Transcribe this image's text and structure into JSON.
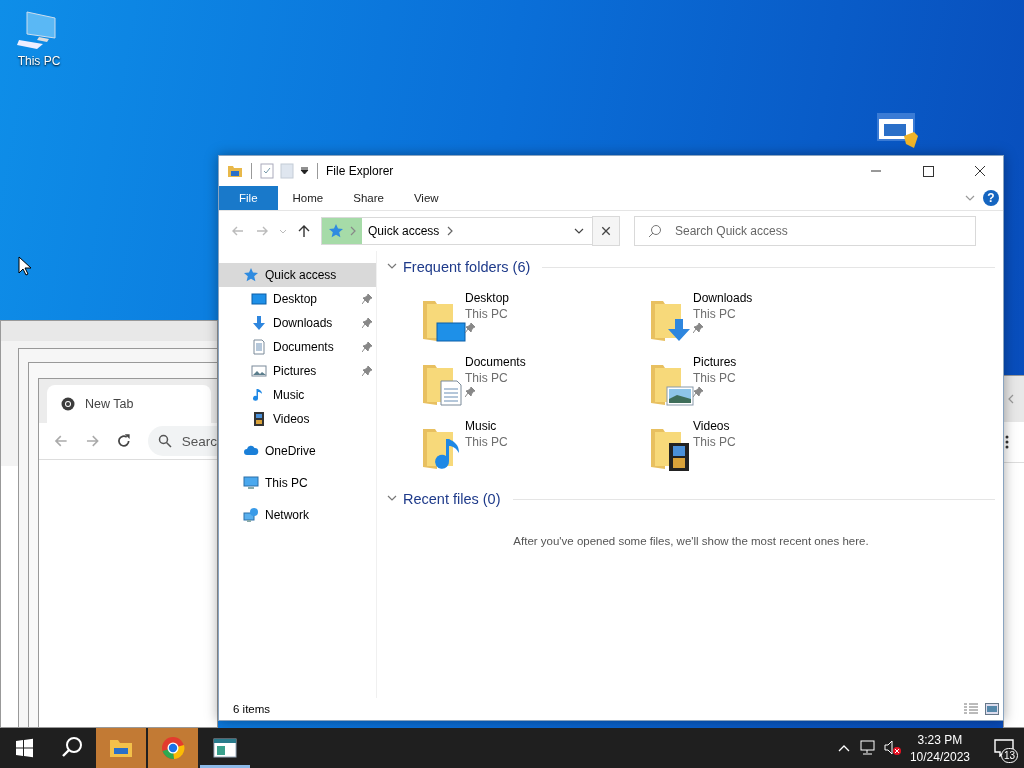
{
  "desktop_icons": [
    {
      "label": "This PC"
    }
  ],
  "browser_window": {
    "tab": "New Tab",
    "search_placeholder": "Searc"
  },
  "explorer": {
    "title": "File Explorer",
    "ribbon_tabs": [
      {
        "label": "File",
        "selected": true
      },
      {
        "label": "Home",
        "selected": false
      },
      {
        "label": "Share",
        "selected": false
      },
      {
        "label": "View",
        "selected": false
      }
    ],
    "help_button": "?",
    "address": {
      "path": "Quick access"
    },
    "search": {
      "placeholder": "Search Quick access"
    },
    "nav": [
      {
        "label": "Quick access",
        "kind": "star",
        "selected": true,
        "pinned": false,
        "children": [
          {
            "label": "Desktop",
            "kind": "desktop",
            "selected": false,
            "pinned": true
          },
          {
            "label": "Downloads",
            "kind": "downloads",
            "selected": false,
            "pinned": true
          },
          {
            "label": "Documents",
            "kind": "documents",
            "selected": false,
            "pinned": true
          },
          {
            "label": "Pictures",
            "kind": "pictures",
            "selected": false,
            "pinned": true
          },
          {
            "label": "Music",
            "kind": "music",
            "selected": false,
            "pinned": false
          },
          {
            "label": "Videos",
            "kind": "videos",
            "selected": false,
            "pinned": false
          }
        ]
      },
      {
        "label": "OneDrive",
        "kind": "cloud",
        "selected": false,
        "pinned": false
      },
      {
        "label": "This PC",
        "kind": "pc",
        "selected": false,
        "pinned": false
      },
      {
        "label": "Network",
        "kind": "network",
        "selected": false,
        "pinned": false
      }
    ],
    "sections": [
      {
        "title": "Frequent folders (6)",
        "expanded": true,
        "items": [
          {
            "name": "Desktop",
            "location": "This PC",
            "kind": "desktop",
            "pinned": true
          },
          {
            "name": "Downloads",
            "location": "This PC",
            "kind": "downloads",
            "pinned": true
          },
          {
            "name": "Documents",
            "location": "This PC",
            "kind": "documents",
            "pinned": true
          },
          {
            "name": "Pictures",
            "location": "This PC",
            "kind": "pictures",
            "pinned": true
          },
          {
            "name": "Music",
            "location": "This PC",
            "kind": "music",
            "pinned": false
          },
          {
            "name": "Videos",
            "location": "This PC",
            "kind": "videos",
            "pinned": false
          }
        ]
      },
      {
        "title": "Recent files (0)",
        "expanded": true,
        "message": "After you've opened some files, we'll show the most recent ones here."
      }
    ],
    "status": "6 items"
  },
  "taskbar": {
    "apps": [
      {
        "kind": "explorer",
        "flashing": true
      },
      {
        "kind": "chrome",
        "flashing": true
      },
      {
        "kind": "app",
        "flashing": false
      }
    ],
    "time": "3:23 PM",
    "date": "10/24/2023",
    "notifications": "13"
  }
}
